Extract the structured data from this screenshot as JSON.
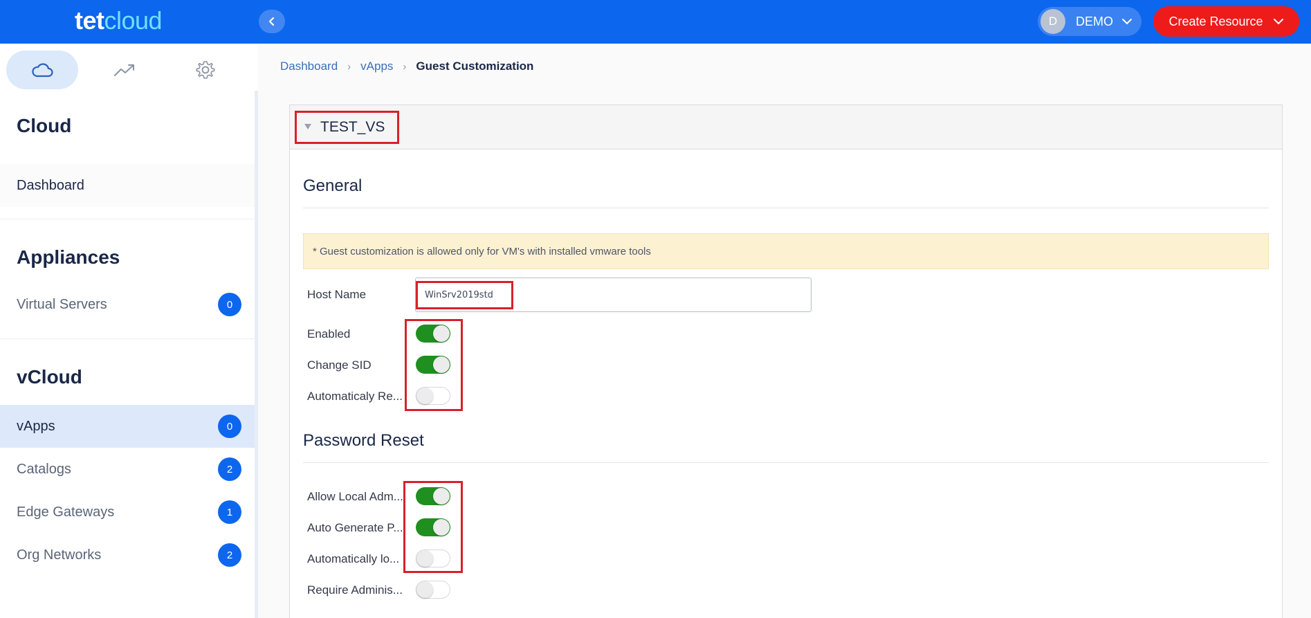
{
  "app": {
    "logo_part1": "tet",
    "logo_part2": "cloud",
    "user_initial": "D",
    "user_name": "DEMO",
    "create_label": "Create Resource",
    "colors": {
      "brand": "#0d66ee",
      "create": "#ee1b1b",
      "toggle_on": "#1f8f1f"
    }
  },
  "sidebar": {
    "tabs": [
      {
        "name": "cloud-icon",
        "active": true
      },
      {
        "name": "trend-icon",
        "active": false
      },
      {
        "name": "gear-icon",
        "active": false
      }
    ],
    "sections": {
      "cloud": "Cloud",
      "appliances": "Appliances",
      "vcloud": "vCloud"
    },
    "items": {
      "dashboard": {
        "label": "Dashboard"
      },
      "virtual_servers": {
        "label": "Virtual Servers",
        "count": "0"
      },
      "vapps": {
        "label": "vApps",
        "count": "0"
      },
      "catalogs": {
        "label": "Catalogs",
        "count": "2"
      },
      "edge_gateways": {
        "label": "Edge Gateways",
        "count": "1"
      },
      "org_networks": {
        "label": "Org Networks",
        "count": "2"
      }
    }
  },
  "breadcrumb": {
    "dashboard": "Dashboard",
    "vapps": "vApps",
    "current": "Guest Customization"
  },
  "vm": {
    "name": "TEST_VS"
  },
  "general": {
    "title": "General",
    "notice": "* Guest customization is allowed only for VM's with installed vmware tools",
    "host_name_label": "Host Name",
    "host_name_value": "WinSrv2019std",
    "enabled_label": "Enabled",
    "enabled": true,
    "change_sid_label": "Change SID",
    "change_sid": true,
    "auto_reboot_label": "Automaticaly Re...",
    "auto_reboot": false
  },
  "password_reset": {
    "title": "Password Reset",
    "allow_local_admin_label": "Allow Local Adm...",
    "allow_local_admin": true,
    "auto_generate_label": "Auto Generate P...",
    "auto_generate": true,
    "auto_logon_label": "Automatically lo...",
    "auto_logon": false,
    "require_admin_label": "Require Adminis...",
    "require_admin": false
  }
}
